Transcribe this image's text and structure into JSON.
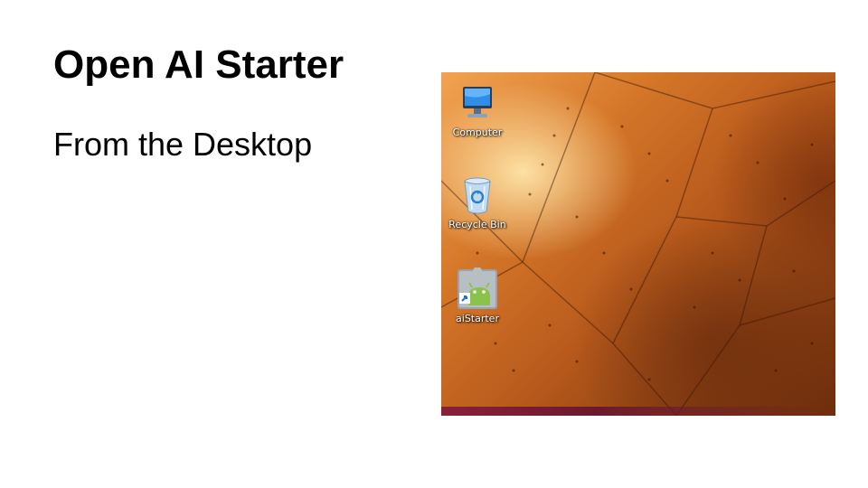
{
  "slide": {
    "title": "Open AI Starter",
    "bullet": "From the Desktop"
  },
  "desktop": {
    "icons": [
      {
        "label": "Computer",
        "icon": "computer-icon"
      },
      {
        "label": "Recycle Bin",
        "icon": "recycle-bin-icon"
      },
      {
        "label": "aiStarter",
        "icon": "aistarter-icon"
      }
    ],
    "colors": {
      "wallpaper_light": "#f2a352",
      "wallpaper_dark": "#6e2e0c"
    }
  }
}
